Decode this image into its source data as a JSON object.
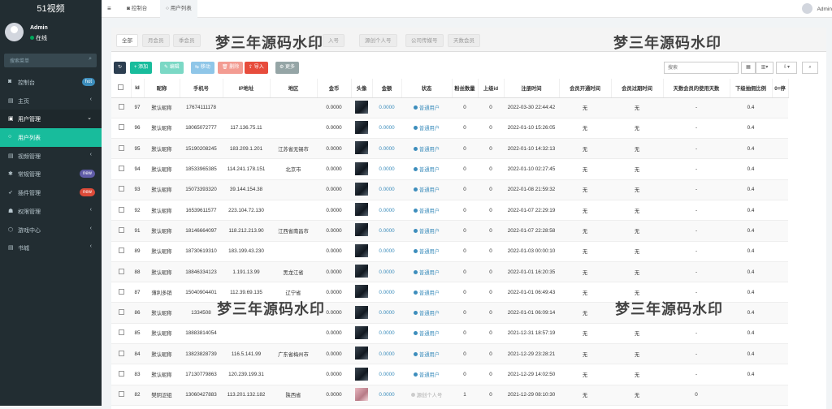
{
  "app": {
    "title": "51视频"
  },
  "user": {
    "name": "Admin",
    "status": "在线",
    "topbar_name": "Admin"
  },
  "sidebar": {
    "search_placeholder": "搜索菜单",
    "items": [
      {
        "label": "控制台",
        "icon": "dashboard-icon",
        "badge": "hot",
        "badge_color": "#3c8dbc"
      },
      {
        "label": "主页",
        "icon": "home-icon",
        "arrow": "‹"
      },
      {
        "label": "用户管理",
        "icon": "user-icon",
        "arrow": "⌄"
      },
      {
        "label": "用户列表",
        "icon": "circle-icon",
        "active": true
      },
      {
        "label": "视频管理",
        "icon": "video-icon",
        "arrow": "‹"
      },
      {
        "label": "常规管理",
        "icon": "cogs-icon",
        "badge": "new",
        "badge_color": "#605ca8"
      },
      {
        "label": "插件管理",
        "icon": "rocket-icon",
        "badge": "new",
        "badge_color": "#dd4b39"
      },
      {
        "label": "权限管理",
        "icon": "group-icon",
        "arrow": "‹"
      },
      {
        "label": "游戏中心",
        "icon": "game-icon",
        "arrow": "‹"
      },
      {
        "label": "书城",
        "icon": "book-icon",
        "arrow": "‹"
      }
    ]
  },
  "topbar": {
    "tabs": [
      "控制台",
      "用户列表"
    ]
  },
  "filter_tabs": [
    "全部",
    "月会员",
    "季会员",
    "",
    "",
    "入号",
    "源创个人号",
    "公司传媒号",
    "天数会员"
  ],
  "watermark": "梦三年源码水印",
  "toolbar": {
    "refresh": "↻",
    "add": "+ 添加",
    "edit": "✎ 编辑",
    "move": "⇆ 移动",
    "delete": "🗑 删除",
    "import": "⇪ 导入",
    "more": "⚙ 更多",
    "search_placeholder": "搜索"
  },
  "table": {
    "headers": [
      "",
      "Id",
      "昵称",
      "手机号",
      "IP地址",
      "地区",
      "金币",
      "头像",
      "金额",
      "状态",
      "粉丝数量",
      "上级id",
      "注册时间",
      "会员开通时间",
      "会员过期时间",
      "天数会员的使用天数",
      "下级抽佣比例",
      "0=停"
    ],
    "rows": [
      {
        "id": "97",
        "nick": "默认昵称",
        "phone": "17674111178",
        "ip": "",
        "area": "",
        "coins": "0.0000",
        "amount": "0.0000",
        "status": "普通用户",
        "fans": "0",
        "parent": "0",
        "reg": "2022-03-30 22:44:42",
        "vip_open": "无",
        "vip_exp": "无",
        "days": "-",
        "ratio": "0.4"
      },
      {
        "id": "96",
        "nick": "默认昵称",
        "phone": "18065072777",
        "ip": "117.136.75.11",
        "area": "",
        "coins": "0.0000",
        "amount": "0.0000",
        "status": "普通用户",
        "fans": "0",
        "parent": "0",
        "reg": "2022-01-10 15:26:05",
        "vip_open": "无",
        "vip_exp": "无",
        "days": "-",
        "ratio": "0.4"
      },
      {
        "id": "95",
        "nick": "默认昵称",
        "phone": "15190208245",
        "ip": "183.209.1.201",
        "area": "江苏省无锡市",
        "coins": "0.0000",
        "amount": "0.0000",
        "status": "普通用户",
        "fans": "0",
        "parent": "0",
        "reg": "2022-01-10 14:32:13",
        "vip_open": "无",
        "vip_exp": "无",
        "days": "-",
        "ratio": "0.4"
      },
      {
        "id": "94",
        "nick": "默认昵称",
        "phone": "18533965385",
        "ip": "114.241.178.151",
        "area": "北京市",
        "coins": "0.0000",
        "amount": "0.0000",
        "status": "普通用户",
        "fans": "0",
        "parent": "0",
        "reg": "2022-01-10 02:27:45",
        "vip_open": "无",
        "vip_exp": "无",
        "days": "-",
        "ratio": "0.4"
      },
      {
        "id": "93",
        "nick": "默认昵称",
        "phone": "15073393320",
        "ip": "39.144.154.38",
        "area": "",
        "coins": "0.0000",
        "amount": "0.0000",
        "status": "普通用户",
        "fans": "0",
        "parent": "0",
        "reg": "2022-01-08 21:59:32",
        "vip_open": "无",
        "vip_exp": "无",
        "days": "-",
        "ratio": "0.4"
      },
      {
        "id": "92",
        "nick": "默认昵称",
        "phone": "16539611577",
        "ip": "223.104.72.130",
        "area": "",
        "coins": "0.0000",
        "amount": "0.0000",
        "status": "普通用户",
        "fans": "0",
        "parent": "0",
        "reg": "2022-01-07 22:29:19",
        "vip_open": "无",
        "vip_exp": "无",
        "days": "-",
        "ratio": "0.4"
      },
      {
        "id": "91",
        "nick": "默认昵称",
        "phone": "18146664097",
        "ip": "118.212.213.90",
        "area": "江西省南昌市",
        "coins": "0.0000",
        "amount": "0.0000",
        "status": "普通用户",
        "fans": "0",
        "parent": "0",
        "reg": "2022-01-07 22:28:58",
        "vip_open": "无",
        "vip_exp": "无",
        "days": "-",
        "ratio": "0.4"
      },
      {
        "id": "89",
        "nick": "默认昵称",
        "phone": "18730619310",
        "ip": "183.199.43.230",
        "area": "",
        "coins": "0.0000",
        "amount": "0.0000",
        "status": "普通用户",
        "fans": "0",
        "parent": "0",
        "reg": "2022-01-03 00:00:10",
        "vip_open": "无",
        "vip_exp": "无",
        "days": "-",
        "ratio": "0.4"
      },
      {
        "id": "88",
        "nick": "默认昵称",
        "phone": "18846334123",
        "ip": "1.191.13.99",
        "area": "黑龙江省",
        "coins": "0.0000",
        "amount": "0.0000",
        "status": "普通用户",
        "fans": "0",
        "parent": "0",
        "reg": "2022-01-01 16:20:35",
        "vip_open": "无",
        "vip_exp": "无",
        "days": "-",
        "ratio": "0.4"
      },
      {
        "id": "87",
        "nick": "薄利多销",
        "phone": "15040904401",
        "ip": "112.39.69.135",
        "area": "辽宁省",
        "coins": "0.0000",
        "amount": "0.0000",
        "status": "普通用户",
        "fans": "0",
        "parent": "0",
        "reg": "2022-01-01 06:49:43",
        "vip_open": "无",
        "vip_exp": "无",
        "days": "-",
        "ratio": "0.4"
      },
      {
        "id": "86",
        "nick": "默认昵称",
        "phone": "1334508",
        "ip": "",
        "area": "",
        "coins": "0.0000",
        "amount": "0.0000",
        "status": "普通用户",
        "fans": "0",
        "parent": "0",
        "reg": "2022-01-01 06:09:14",
        "vip_open": "无",
        "vip_exp": "",
        "days": "-",
        "ratio": "0.4"
      },
      {
        "id": "85",
        "nick": "默认昵称",
        "phone": "18883814054",
        "ip": "",
        "area": "",
        "coins": "0.0000",
        "amount": "0.0000",
        "status": "普通用户",
        "fans": "0",
        "parent": "0",
        "reg": "2021-12-31 18:57:19",
        "vip_open": "无",
        "vip_exp": "无",
        "days": "-",
        "ratio": "0.4"
      },
      {
        "id": "84",
        "nick": "默认昵称",
        "phone": "13823828739",
        "ip": "116.5.141.99",
        "area": "广东省梅州市",
        "coins": "0.0000",
        "amount": "0.0000",
        "status": "普通用户",
        "fans": "0",
        "parent": "0",
        "reg": "2021-12-29 23:28:21",
        "vip_open": "无",
        "vip_exp": "无",
        "days": "-",
        "ratio": "0.4"
      },
      {
        "id": "83",
        "nick": "默认昵称",
        "phone": "17130779863",
        "ip": "120.239.199.31",
        "area": "",
        "coins": "0.0000",
        "amount": "0.0000",
        "status": "普通用户",
        "fans": "0",
        "parent": "0",
        "reg": "2021-12-29 14:02:50",
        "vip_open": "无",
        "vip_exp": "无",
        "days": "-",
        "ratio": "0.4"
      },
      {
        "id": "82",
        "nick": "樊阴涩组",
        "phone": "13060427883",
        "ip": "113.201.132.182",
        "area": "陕西省",
        "coins": "0.0000",
        "amount": "0.0000",
        "status": "源创个人号",
        "fans": "1",
        "parent": "0",
        "reg": "2021-12-29 08:10:30",
        "vip_open": "无",
        "vip_exp": "无",
        "days": "0",
        "ratio": ""
      }
    ]
  }
}
